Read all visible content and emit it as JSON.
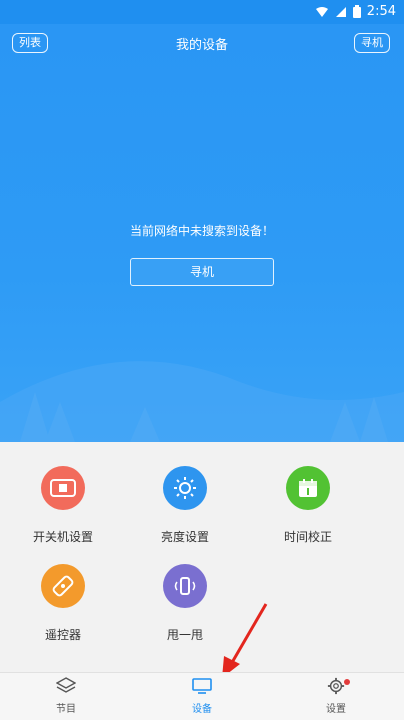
{
  "status_bar": {
    "time": "2:54"
  },
  "header": {
    "left_chip": "列表",
    "title": "我的设备",
    "right_chip": "寻机"
  },
  "hero": {
    "message": "当前网络中未搜索到设备！",
    "search_button": "寻机"
  },
  "features": [
    {
      "label": "开关机设置",
      "icon": "power-toggle-icon",
      "color": "#f26b5b"
    },
    {
      "label": "亮度设置",
      "icon": "sun-icon",
      "color": "#2e95ef"
    },
    {
      "label": "时间校正",
      "icon": "calendar-icon",
      "color": "#52c233"
    },
    {
      "label": "遥控器",
      "icon": "remote-control-icon",
      "color": "#f39a2c"
    },
    {
      "label": "甩一甩",
      "icon": "shake-icon",
      "color": "#7a6fd0"
    }
  ],
  "bottom_nav": {
    "items": [
      {
        "label": "节目",
        "icon": "layers-icon"
      },
      {
        "label": "设备",
        "icon": "monitor-icon",
        "active": true
      },
      {
        "label": "设置",
        "icon": "gear-icon",
        "badge": true
      }
    ]
  },
  "colors": {
    "primary": "#1f8ff0",
    "badge": "#e23b3b"
  }
}
